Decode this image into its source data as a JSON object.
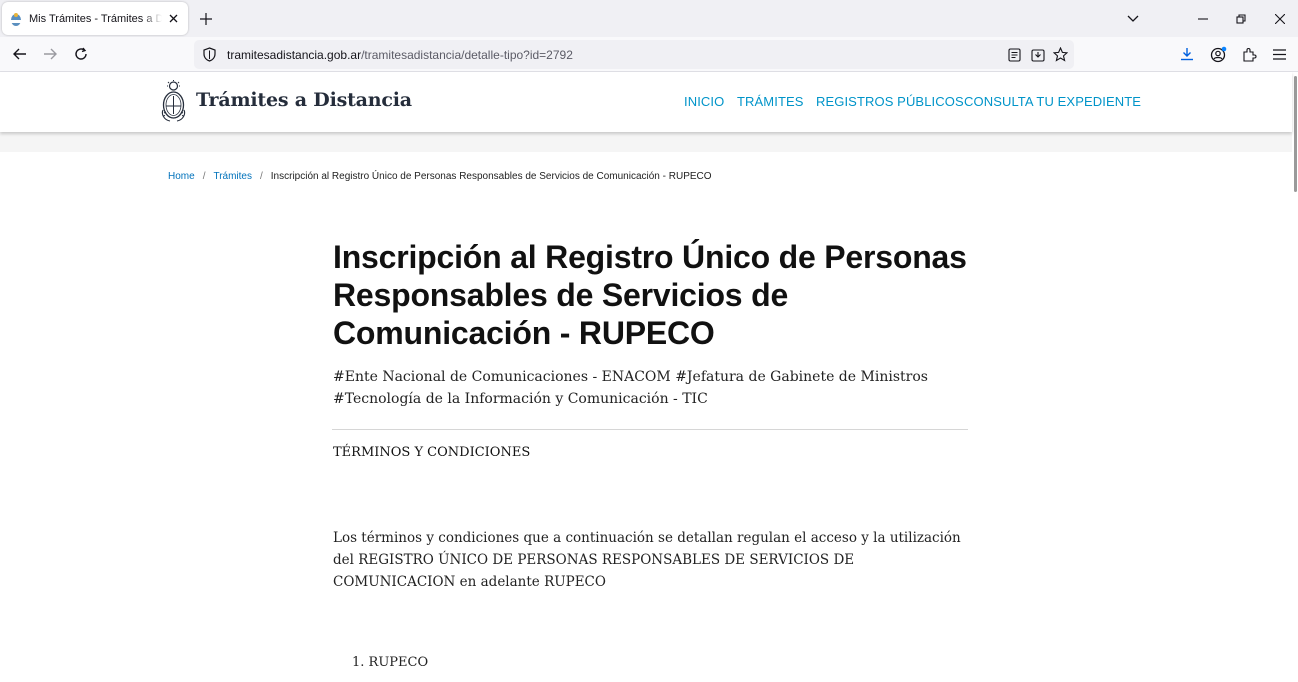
{
  "browser": {
    "tab_title": "Mis Trámites - Trámites a Distancia",
    "url_host": "tramitesadistancia.gob.ar",
    "url_path": "/tramitesadistancia/detalle-tipo?id=2792"
  },
  "site": {
    "logo_text": "Trámites a Distancia",
    "nav": [
      "INICIO",
      "TRÁMITES",
      "REGISTROS PÚBLICOS",
      "CONSULTA TU EXPEDIENTE"
    ],
    "accent_color": "#0094c9"
  },
  "breadcrumb": {
    "home": "Home",
    "sep": "/",
    "tramites": "Trámites",
    "current": "Inscripción al Registro Único de Personas Responsables de Servicios de Comunicación - RUPECO"
  },
  "main": {
    "title": "Inscripción al Registro Único de Personas Responsables de Servicios de Comunicación - RUPECO",
    "tags": "#Ente Nacional de Comunicaciones - ENACOM #Jefatura de Gabinete de Ministros #Tecnología de la Información y Comunicación - TIC",
    "section_title": "TÉRMINOS Y CONDICIONES",
    "paragraph": "Los términos y condiciones que a continuación se detallan regulan el acceso y la utilización del REGISTRO ÚNICO DE PERSONAS RESPONSABLES DE SERVICIOS DE COMUNICACION en adelante RUPECO",
    "list_items": [
      "1. RUPECO"
    ]
  }
}
